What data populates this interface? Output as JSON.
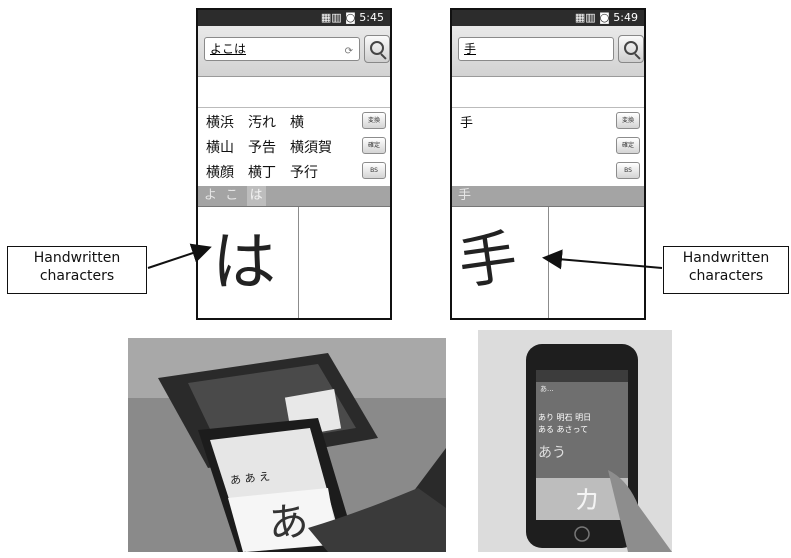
{
  "left_phone": {
    "time": "5:45",
    "search_value": "よこは",
    "candidates": [
      [
        "横浜",
        "汚れ",
        "横"
      ],
      [
        "横山",
        "予告",
        "横須賀"
      ],
      [
        "横顔",
        "横丁",
        "予行"
      ]
    ],
    "buttons": [
      "変換",
      "確定",
      "BS"
    ],
    "reading": [
      "よ",
      "こ",
      "は"
    ],
    "handwriting": "は"
  },
  "right_phone": {
    "time": "5:49",
    "search_value": "手",
    "candidates": [
      [
        "手"
      ]
    ],
    "buttons": [
      "変換",
      "確定",
      "BS"
    ],
    "reading": [
      "手"
    ],
    "handwriting": "手"
  },
  "labels": {
    "left": [
      "Handwritten",
      "characters"
    ],
    "right": [
      "Handwritten",
      "characters"
    ]
  },
  "photos": {
    "left": {
      "candidate_row": "あ あ え",
      "handwriting": "あ"
    },
    "right": {
      "header": "あ...",
      "candidates": [
        "あり 明石 明日",
        "ある あさって"
      ],
      "reading": "あう",
      "handwriting": "カ"
    }
  },
  "colors": {
    "status_bar": "#2c2c2c",
    "reading_bar": "#a4a4a4",
    "photo_bg": "#8e8e8e"
  }
}
